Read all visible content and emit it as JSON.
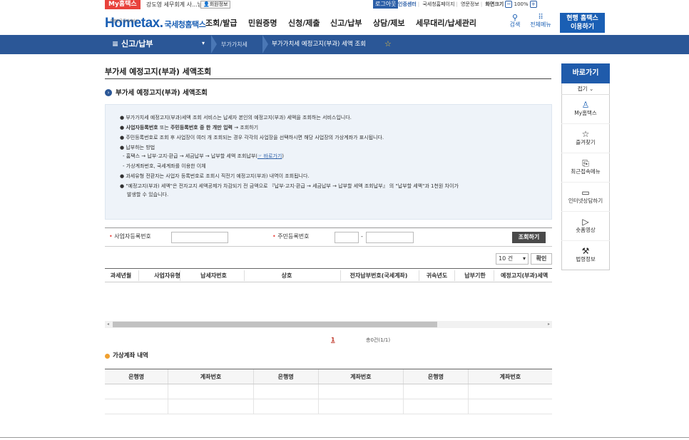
{
  "top": {
    "my_hometax": "My홈택스",
    "user_name": "강도영 세무회계 사...님",
    "user_info": "회원정보",
    "logout": "로그아웃",
    "links": [
      "인증센터",
      "국세청홈페이지",
      "영문정보"
    ],
    "zoom_label": "화면크기",
    "zoom_value": "100%"
  },
  "header": {
    "logo_text": "Hometax.",
    "logo_sub": "국세청홈택스",
    "logo_tiny": "대한민국 국세서비스",
    "menus": [
      "조회/발급",
      "민원증명",
      "신청/제출",
      "신고/납부",
      "상담/제보",
      "세무대리/납세관리"
    ],
    "search": "검색",
    "all_menu": "전체메뉴",
    "use_btn_line1": "현행 홈택스",
    "use_btn_line2": "이용하기"
  },
  "nav": {
    "menu": "≡ 신고/납부",
    "crumb1": "부가가치세",
    "crumb2": "부가가치세 예정고지(부과) 세액 조회"
  },
  "page": {
    "title": "부가세 예정고지(부과) 세액조회",
    "section_title": "부가세 예정고지(부과) 세액조회"
  },
  "info": {
    "l1": "● 부가가치세 예정고지(부과)세액 조회 서비스는 납세자 본인의 예정고지(부과) 세액을 조회하는 서비스입니다.",
    "l2a": "● 사업자등록번호",
    "l2b": " 또는 ",
    "l2c": "주민등록번호 중 한 개만 입력",
    "l2d": " → 조회하기",
    "l3": "● 주민등록번호로 조회 후 사업장이 여러 개 조회되는 경우 각각의 사업장을 선택하시면 해당 사업장의 가상계좌가 표시됩니다.",
    "l4": "● 납부하는 방법",
    "l5a": "- 홈택스 → 납부·고지·환급 → 세금납부 → 납부할 세액 조회납부(",
    "l5b": "☞ 바로가기",
    "l5c": ")",
    "l6": "- 가상계좌번호, 국세계좌를 이용한 이체",
    "l7": "● 과세유형 전환자는 사업자 등록번호로 조회시 직전기 예정고지(부과) 내역이 조회됩니다.",
    "l8": "● \"예정고지(부과) 세액\"은 전자고지 세액공제가 차감되기 전 금액으로 『납부·고지·환급 → 세금납부 → 납부할 세액 조회납부』 의 \"납부할 세액\"과 1천원 차이가",
    "l9": "발생할 수 있습니다."
  },
  "form": {
    "bizno_label": "사업자등록번호",
    "resno_label": "주민등록번호",
    "dash": "-",
    "submit": "조회하기",
    "page_size": "10 건",
    "confirm": "확인"
  },
  "grid": {
    "headers": [
      "과세년월",
      "사업자유형",
      "납세자번호",
      "상호",
      "전자납부번호(국세계좌)",
      "귀속년도",
      "납부기한",
      "예정고지(부과)세액"
    ],
    "page": "1",
    "total": "총0건(1/1)"
  },
  "va": {
    "title": "가상계좌 내역",
    "headers": [
      "은행명",
      "계좌번호",
      "은행명",
      "계좌번호",
      "은행명",
      "계좌번호"
    ]
  },
  "quick": {
    "title": "바로가기",
    "fold": "접기 ⌄",
    "items": [
      {
        "label": "My홈택스",
        "icon": "user-icon"
      },
      {
        "label": "즐겨찾기",
        "icon": "star-icon"
      },
      {
        "label": "최근접속메뉴",
        "icon": "recent-icon"
      },
      {
        "label": "인터넷상담하기",
        "icon": "monitor-icon"
      },
      {
        "label": "숏폼영상",
        "icon": "play-icon"
      },
      {
        "label": "법령정보",
        "icon": "gavel-icon"
      }
    ]
  },
  "colors": {
    "brand": "#1a5fb4",
    "nav": "#2b5797",
    "accent": "#e8423c"
  }
}
